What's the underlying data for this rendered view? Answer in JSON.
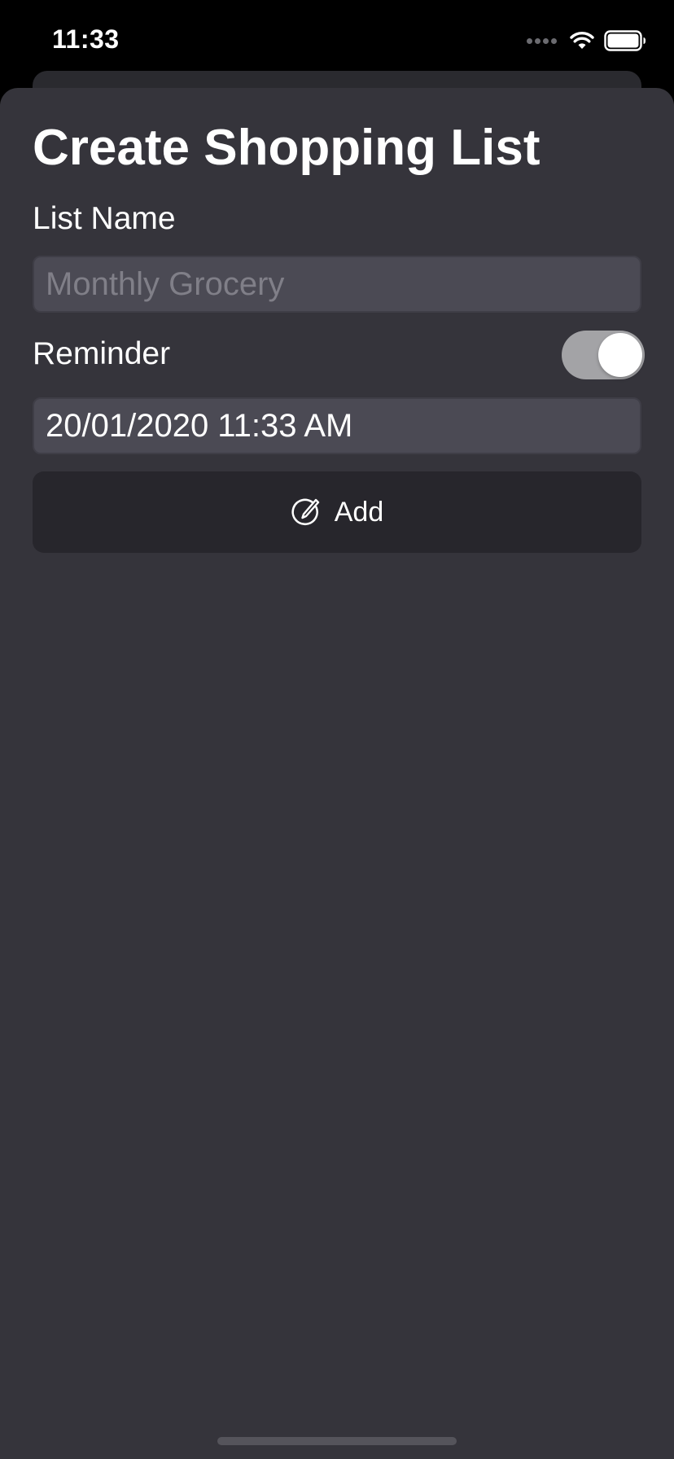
{
  "status_bar": {
    "time": "11:33",
    "icons": [
      "signal-dots-icon",
      "wifi-icon",
      "battery-icon"
    ]
  },
  "sheet": {
    "title": "Create Shopping List",
    "list_name": {
      "label": "List Name",
      "value": "",
      "placeholder": "Monthly Grocery"
    },
    "reminder": {
      "label": "Reminder",
      "enabled": true,
      "datetime": "20/01/2020 11:33 AM"
    },
    "add_button": {
      "label": "Add",
      "icon": "edit-circle-icon"
    }
  },
  "colors": {
    "background": "#000000",
    "sheet": "#35343b",
    "field": "#4b4a54",
    "button": "#27262c",
    "toggle_track": "#a3a3a6",
    "placeholder": "#807f88"
  }
}
